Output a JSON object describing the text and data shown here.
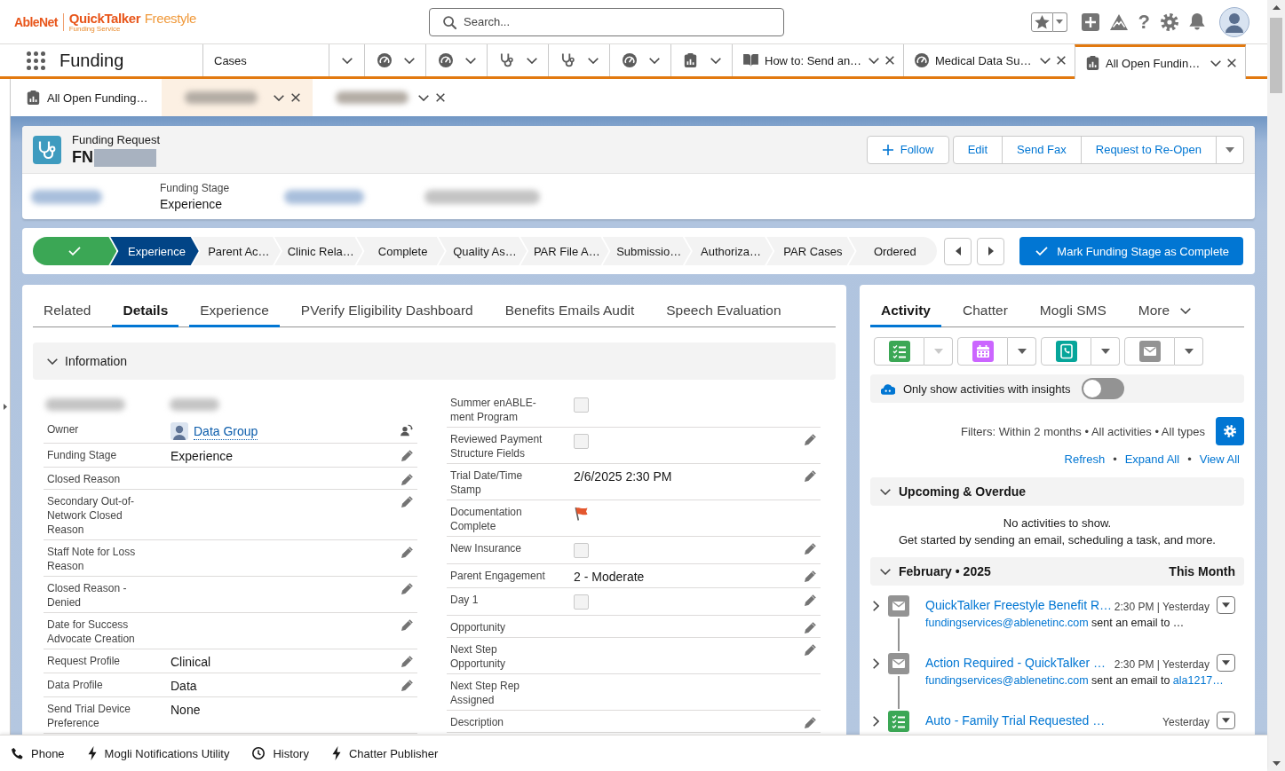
{
  "header": {
    "logo": {
      "brand": "AbleNet",
      "product": "**QuickTalker** Freestyle",
      "tagline": "Funding Service"
    },
    "search": {
      "placeholder": "Search..."
    },
    "help": "?"
  },
  "nav": {
    "app_name": "Funding",
    "menu_item": {
      "label": "Cases"
    },
    "tabs": [
      {
        "kind": "dashboard",
        "selected": false
      },
      {
        "kind": "dashboard",
        "selected": false
      },
      {
        "kind": "funding",
        "selected": false
      },
      {
        "kind": "funding",
        "selected": false
      },
      {
        "kind": "dashboard",
        "selected": false
      },
      {
        "kind": "report",
        "selected": false
      },
      {
        "kind": "article",
        "label": "How to: Send an…",
        "selected": false
      },
      {
        "kind": "dashboard",
        "label": "Medical Data Su…",
        "selected": false
      },
      {
        "kind": "report",
        "label": "All Open Fundin…",
        "selected": true
      }
    ]
  },
  "subtabs": [
    {
      "kind": "report",
      "label": "All Open Funding…",
      "selected": false
    },
    {
      "kind": "redacted",
      "selected": true
    },
    {
      "kind": "redacted",
      "selected": false
    }
  ],
  "record": {
    "object_label": "Funding Request",
    "name": "FN",
    "name_redacted": true,
    "follow": "Follow",
    "actions": [
      "Edit",
      "Send Fax",
      "Request to Re-Open"
    ],
    "highlights": [
      {
        "kind": "redacted"
      },
      {
        "kind": "field",
        "label": "Funding Stage",
        "value": "Experience"
      },
      {
        "kind": "redacted"
      },
      {
        "kind": "redacted"
      }
    ]
  },
  "path": {
    "stages": [
      {
        "kind": "complete"
      },
      {
        "kind": "current",
        "label": "Experience"
      },
      {
        "kind": "incomplete",
        "label": "Parent Ac…"
      },
      {
        "kind": "incomplete",
        "label": "Clinic Rela…"
      },
      {
        "kind": "incomplete",
        "label": "Complete"
      },
      {
        "kind": "incomplete",
        "label": "Quality As…"
      },
      {
        "kind": "incomplete",
        "label": "PAR File A…"
      },
      {
        "kind": "incomplete",
        "label": "Submissio…"
      },
      {
        "kind": "incomplete",
        "label": "Authoriza…"
      },
      {
        "kind": "incomplete",
        "label": "PAR Cases"
      },
      {
        "kind": "incomplete",
        "label": "Ordered"
      }
    ],
    "mark_complete": "Mark Funding Stage as Complete"
  },
  "details": {
    "tabs": [
      {
        "label": "Related",
        "selected": false,
        "underlined": false
      },
      {
        "label": "Details",
        "selected": true,
        "underlined": false
      },
      {
        "label": "Experience",
        "selected": false,
        "underlined": true
      },
      {
        "label": "PVerify Eligibility Dashboard",
        "selected": false,
        "underlined": false
      },
      {
        "label": "Benefits Emails Audit",
        "selected": false,
        "underlined": false
      },
      {
        "label": "Speech Evaluation",
        "selected": false,
        "underlined": false
      }
    ],
    "section": {
      "title": "Information",
      "expanded": true
    },
    "left_fields": [
      {
        "kind": "redacted"
      },
      {
        "kind": "link",
        "label": "Owner",
        "value": "Data Group",
        "editable": true
      },
      {
        "kind": "text",
        "label": "Funding Stage",
        "value": "Experience",
        "editable": true
      },
      {
        "kind": "text",
        "label": "Closed Reason",
        "editable": true
      },
      {
        "kind": "text",
        "label": "Secondary Out-of-Network Closed Reason",
        "editable": true
      },
      {
        "kind": "text",
        "label": "Staff Note for Loss Reason",
        "editable": true
      },
      {
        "kind": "text",
        "label": "Closed Reason - Denied",
        "editable": true
      },
      {
        "kind": "text",
        "label": "Date for Success Advocate Creation",
        "editable": true
      },
      {
        "kind": "text",
        "label": "Request Profile",
        "value": "Clinical",
        "editable": true
      },
      {
        "kind": "text",
        "label": "Data Profile",
        "value": "Data",
        "editable": true
      },
      {
        "kind": "text",
        "label": "Send Trial Device Preference",
        "value": "None",
        "editable": false
      }
    ],
    "right_fields": [
      {
        "kind": "checkbox",
        "label": "Summer enABLE-ment Program",
        "checked": false,
        "editable": false
      },
      {
        "kind": "checkbox",
        "label": "Reviewed Payment Structure Fields",
        "checked": false,
        "editable": true
      },
      {
        "kind": "text",
        "label": "Trial Date/Time Stamp",
        "value": "2/6/2025 2:30 PM",
        "editable": true
      },
      {
        "kind": "flag",
        "label": "Documentation Complete",
        "editable": false
      },
      {
        "kind": "checkbox",
        "label": "New Insurance",
        "checked": false,
        "editable": true
      },
      {
        "kind": "text",
        "label": "Parent Engagement",
        "value": "2 - Moderate",
        "editable": true
      },
      {
        "kind": "checkbox",
        "label": "Day 1",
        "checked": false,
        "editable": true
      },
      {
        "kind": "text",
        "label": "Opportunity",
        "editable": true
      },
      {
        "kind": "text",
        "label": "Next Step Opportunity",
        "editable": true
      },
      {
        "kind": "text",
        "label": "Next Step Rep Assigned",
        "editable": false
      },
      {
        "kind": "text",
        "label": "Description",
        "editable": true
      }
    ]
  },
  "activity": {
    "tabs": [
      {
        "kind": "tab",
        "label": "Activity",
        "selected": true
      },
      {
        "kind": "tab",
        "label": "Chatter",
        "selected": false
      },
      {
        "kind": "tab",
        "label": "Mogli SMS",
        "selected": false
      },
      {
        "kind": "menu",
        "label": "More",
        "selected": false
      }
    ],
    "quick_actions": [
      {
        "kind": "task",
        "menu_disabled": true
      },
      {
        "kind": "event",
        "menu_disabled": false
      },
      {
        "kind": "call",
        "menu_disabled": false
      },
      {
        "kind": "email",
        "menu_disabled": false
      }
    ],
    "insights": {
      "label": "Only show activities with insights",
      "on": false
    },
    "filters": "Filters: Within 2 months • All activities • All types",
    "links": [
      {
        "kind": "link",
        "text": "Refresh"
      },
      {
        "kind": "separator",
        "text": "•"
      },
      {
        "kind": "link",
        "text": "Expand All"
      },
      {
        "kind": "separator",
        "text": "•"
      },
      {
        "kind": "link",
        "text": "View All"
      }
    ],
    "sections": [
      {
        "title": "Upcoming & Overdue",
        "expanded": true,
        "empty_title": "No activities to show.",
        "empty_text": "Get started by sending an email, scheduling a task, and more."
      },
      {
        "title": "February • 2025",
        "badge": "This Month",
        "expanded": true,
        "items": [
          {
            "kind": "email",
            "expanded": false,
            "subject": "QuickTalker Freestyle Benefit R…",
            "time": "2:30 PM | Yesterday",
            "sender": "fundingservices@ablenetinc.com",
            "text": "sent an email to …"
          },
          {
            "kind": "email",
            "expanded": false,
            "subject": "Action Required - QuickTalker …",
            "time": "2:30 PM | Yesterday",
            "sender": "fundingservices@ablenetinc.com",
            "text": "sent an email to",
            "recipient": "ala1217…"
          },
          {
            "kind": "task",
            "expanded": false,
            "subject": "Auto - Family Trial Requested …",
            "time": "Yesterday"
          }
        ]
      }
    ]
  },
  "utility_bar": [
    {
      "kind": "phone",
      "label": "Phone"
    },
    {
      "kind": "lightning",
      "label": "Mogli Notifications Utility"
    },
    {
      "kind": "history",
      "label": "History"
    },
    {
      "kind": "lightning",
      "label": "Chatter Publisher"
    }
  ]
}
